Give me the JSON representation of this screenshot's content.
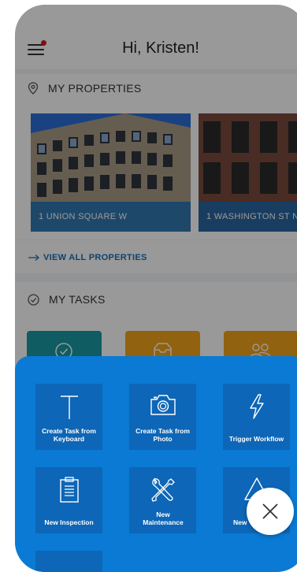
{
  "header": {
    "greeting": "Hi, Kristen!"
  },
  "properties": {
    "title": "MY PROPERTIES",
    "items": [
      {
        "label": "1 UNION SQUARE W"
      },
      {
        "label": "1 WASHINGTON ST N"
      }
    ],
    "view_all": "VIEW ALL PROPERTIES"
  },
  "tasks": {
    "title": "MY TASKS"
  },
  "actions": [
    {
      "label": "Create Task from Keyboard",
      "icon": "text-cursor-icon"
    },
    {
      "label": "Create Task from Photo",
      "icon": "camera-icon"
    },
    {
      "label": "Trigger Workflow",
      "icon": "lightning-icon"
    },
    {
      "label": "New Inspection",
      "icon": "clipboard-icon"
    },
    {
      "label": "New Maintenance",
      "icon": "tools-icon"
    },
    {
      "label": "New",
      "icon": "warning-icon"
    }
  ],
  "colors": {
    "accent": "#0a7ad4",
    "tile": "#0d66b7",
    "teal": "#1a9aa4",
    "amber": "#f2a31b"
  }
}
